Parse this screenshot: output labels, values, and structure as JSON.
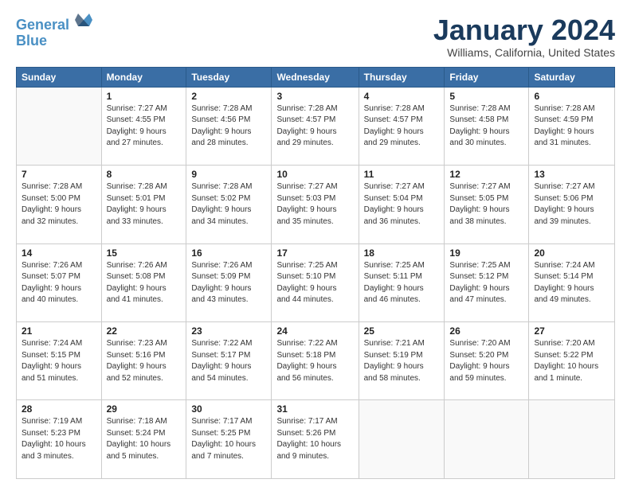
{
  "header": {
    "logo_line1": "General",
    "logo_line2": "Blue",
    "month": "January 2024",
    "location": "Williams, California, United States"
  },
  "days_of_week": [
    "Sunday",
    "Monday",
    "Tuesday",
    "Wednesday",
    "Thursday",
    "Friday",
    "Saturday"
  ],
  "weeks": [
    [
      {
        "num": "",
        "info": ""
      },
      {
        "num": "1",
        "info": "Sunrise: 7:27 AM\nSunset: 4:55 PM\nDaylight: 9 hours\nand 27 minutes."
      },
      {
        "num": "2",
        "info": "Sunrise: 7:28 AM\nSunset: 4:56 PM\nDaylight: 9 hours\nand 28 minutes."
      },
      {
        "num": "3",
        "info": "Sunrise: 7:28 AM\nSunset: 4:57 PM\nDaylight: 9 hours\nand 29 minutes."
      },
      {
        "num": "4",
        "info": "Sunrise: 7:28 AM\nSunset: 4:57 PM\nDaylight: 9 hours\nand 29 minutes."
      },
      {
        "num": "5",
        "info": "Sunrise: 7:28 AM\nSunset: 4:58 PM\nDaylight: 9 hours\nand 30 minutes."
      },
      {
        "num": "6",
        "info": "Sunrise: 7:28 AM\nSunset: 4:59 PM\nDaylight: 9 hours\nand 31 minutes."
      }
    ],
    [
      {
        "num": "7",
        "info": "Sunrise: 7:28 AM\nSunset: 5:00 PM\nDaylight: 9 hours\nand 32 minutes."
      },
      {
        "num": "8",
        "info": "Sunrise: 7:28 AM\nSunset: 5:01 PM\nDaylight: 9 hours\nand 33 minutes."
      },
      {
        "num": "9",
        "info": "Sunrise: 7:28 AM\nSunset: 5:02 PM\nDaylight: 9 hours\nand 34 minutes."
      },
      {
        "num": "10",
        "info": "Sunrise: 7:27 AM\nSunset: 5:03 PM\nDaylight: 9 hours\nand 35 minutes."
      },
      {
        "num": "11",
        "info": "Sunrise: 7:27 AM\nSunset: 5:04 PM\nDaylight: 9 hours\nand 36 minutes."
      },
      {
        "num": "12",
        "info": "Sunrise: 7:27 AM\nSunset: 5:05 PM\nDaylight: 9 hours\nand 38 minutes."
      },
      {
        "num": "13",
        "info": "Sunrise: 7:27 AM\nSunset: 5:06 PM\nDaylight: 9 hours\nand 39 minutes."
      }
    ],
    [
      {
        "num": "14",
        "info": "Sunrise: 7:26 AM\nSunset: 5:07 PM\nDaylight: 9 hours\nand 40 minutes."
      },
      {
        "num": "15",
        "info": "Sunrise: 7:26 AM\nSunset: 5:08 PM\nDaylight: 9 hours\nand 41 minutes."
      },
      {
        "num": "16",
        "info": "Sunrise: 7:26 AM\nSunset: 5:09 PM\nDaylight: 9 hours\nand 43 minutes."
      },
      {
        "num": "17",
        "info": "Sunrise: 7:25 AM\nSunset: 5:10 PM\nDaylight: 9 hours\nand 44 minutes."
      },
      {
        "num": "18",
        "info": "Sunrise: 7:25 AM\nSunset: 5:11 PM\nDaylight: 9 hours\nand 46 minutes."
      },
      {
        "num": "19",
        "info": "Sunrise: 7:25 AM\nSunset: 5:12 PM\nDaylight: 9 hours\nand 47 minutes."
      },
      {
        "num": "20",
        "info": "Sunrise: 7:24 AM\nSunset: 5:14 PM\nDaylight: 9 hours\nand 49 minutes."
      }
    ],
    [
      {
        "num": "21",
        "info": "Sunrise: 7:24 AM\nSunset: 5:15 PM\nDaylight: 9 hours\nand 51 minutes."
      },
      {
        "num": "22",
        "info": "Sunrise: 7:23 AM\nSunset: 5:16 PM\nDaylight: 9 hours\nand 52 minutes."
      },
      {
        "num": "23",
        "info": "Sunrise: 7:22 AM\nSunset: 5:17 PM\nDaylight: 9 hours\nand 54 minutes."
      },
      {
        "num": "24",
        "info": "Sunrise: 7:22 AM\nSunset: 5:18 PM\nDaylight: 9 hours\nand 56 minutes."
      },
      {
        "num": "25",
        "info": "Sunrise: 7:21 AM\nSunset: 5:19 PM\nDaylight: 9 hours\nand 58 minutes."
      },
      {
        "num": "26",
        "info": "Sunrise: 7:20 AM\nSunset: 5:20 PM\nDaylight: 9 hours\nand 59 minutes."
      },
      {
        "num": "27",
        "info": "Sunrise: 7:20 AM\nSunset: 5:22 PM\nDaylight: 10 hours\nand 1 minute."
      }
    ],
    [
      {
        "num": "28",
        "info": "Sunrise: 7:19 AM\nSunset: 5:23 PM\nDaylight: 10 hours\nand 3 minutes."
      },
      {
        "num": "29",
        "info": "Sunrise: 7:18 AM\nSunset: 5:24 PM\nDaylight: 10 hours\nand 5 minutes."
      },
      {
        "num": "30",
        "info": "Sunrise: 7:17 AM\nSunset: 5:25 PM\nDaylight: 10 hours\nand 7 minutes."
      },
      {
        "num": "31",
        "info": "Sunrise: 7:17 AM\nSunset: 5:26 PM\nDaylight: 10 hours\nand 9 minutes."
      },
      {
        "num": "",
        "info": ""
      },
      {
        "num": "",
        "info": ""
      },
      {
        "num": "",
        "info": ""
      }
    ]
  ]
}
